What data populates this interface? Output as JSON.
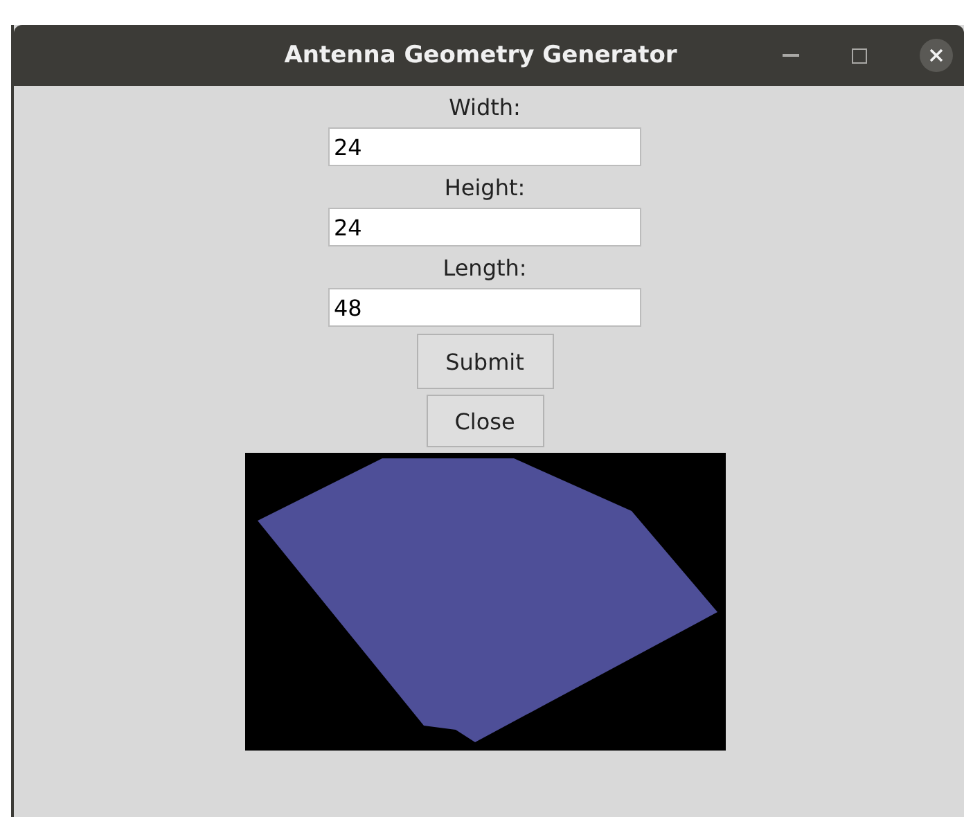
{
  "window": {
    "title": "Antenna Geometry Generator"
  },
  "fields": [
    {
      "label": "Width:",
      "value": "24"
    },
    {
      "label": "Height:",
      "value": "24"
    },
    {
      "label": "Length:",
      "value": "48"
    }
  ],
  "buttons": [
    "Submit",
    "Close"
  ]
}
